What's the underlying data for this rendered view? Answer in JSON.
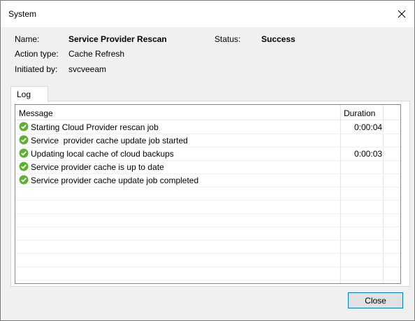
{
  "window": {
    "title": "System"
  },
  "info": {
    "name_label": "Name:",
    "name_value": "Service Provider Rescan",
    "status_label": "Status:",
    "status_value": "Success",
    "action_label": "Action type:",
    "action_value": "Cache Refresh",
    "initiated_label": "Initiated by:",
    "initiated_value": "svcveeam"
  },
  "tabs": [
    {
      "label": "Log"
    }
  ],
  "log": {
    "columns": [
      "Message",
      "Duration"
    ],
    "rows": [
      {
        "status": "success",
        "message": "Starting Cloud Provider rescan job",
        "duration": "0:00:04"
      },
      {
        "status": "success",
        "message": "Service  provider cache update job started",
        "duration": ""
      },
      {
        "status": "success",
        "message": "Updating local cache of cloud backups",
        "duration": "0:00:03"
      },
      {
        "status": "success",
        "message": "Service provider cache is up to date",
        "duration": ""
      },
      {
        "status": "success",
        "message": "Service provider cache update job completed",
        "duration": ""
      }
    ]
  },
  "buttons": {
    "close": "Close"
  },
  "colors": {
    "success_green": "#5cb130",
    "accent_border": "#0078d7"
  },
  "icons": {
    "row_status": "success-check-icon",
    "window_close": "close-icon"
  }
}
